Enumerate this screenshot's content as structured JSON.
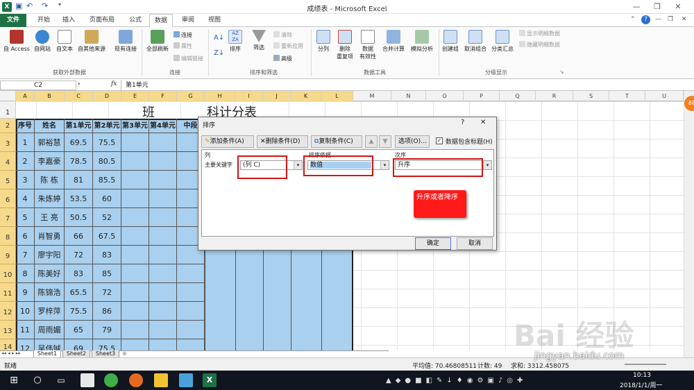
{
  "window": {
    "title": "成绩表 - Microsoft Excel"
  },
  "tabs": [
    "文件",
    "开始",
    "插入",
    "页面布局",
    "公式",
    "数据",
    "审阅",
    "视图"
  ],
  "ribbon": {
    "get_external": {
      "access": "自 Access",
      "web": "自网站",
      "text": "自文本",
      "other": "自其他来源",
      "existing": "现有连接",
      "group": "获取外部数据"
    },
    "connections": {
      "refresh": "全部刷新",
      "connect": "连接",
      "properties": "属性",
      "edit_links": "编辑链接",
      "group": "连接"
    },
    "sort_filter": {
      "sort": "排序",
      "filter": "筛选",
      "clear": "清除",
      "reapply": "重新应用",
      "advanced": "高级",
      "group": "排序和筛选"
    },
    "data_tools": {
      "text_to_cols": "分列",
      "remove_dup_1": "删除",
      "remove_dup_2": "重复项",
      "validation_1": "数据",
      "validation_2": "有效性",
      "consolidate": "合并计算",
      "whatif": "模拟分析",
      "group": "数据工具"
    },
    "outline": {
      "group_btn": "创建组",
      "ungroup": "取消组合",
      "subtotal": "分类汇总",
      "show_detail": "显示明细数据",
      "hide_detail": "隐藏明细数据",
      "group": "分级显示"
    }
  },
  "formula_bar": {
    "name_box": "C2",
    "fx": "fx",
    "value": "第1单元"
  },
  "columns": [
    "A",
    "B",
    "C",
    "D",
    "E",
    "F",
    "G",
    "H",
    "I",
    "J",
    "K",
    "L",
    "M",
    "N",
    "O",
    "P",
    "Q",
    "R",
    "S",
    "T",
    "U"
  ],
  "rows": [
    "1",
    "2",
    "3",
    "4",
    "5",
    "6",
    "7",
    "8",
    "9",
    "10",
    "11",
    "12",
    "13",
    "14"
  ],
  "sheet": {
    "title_left": "班",
    "title_right": "科计分表",
    "headers": [
      "序号",
      "姓名",
      "第1单元",
      "第2单元",
      "第3单元",
      "第4单元",
      "中段"
    ],
    "data": [
      [
        "1",
        "郭裕慧",
        "69.5",
        "75.5"
      ],
      [
        "2",
        "李嘉豪",
        "78.5",
        "80.5"
      ],
      [
        "3",
        "陈 栋",
        "81",
        "85.5"
      ],
      [
        "4",
        "朱炼婷",
        "53.5",
        "60"
      ],
      [
        "5",
        "王 亮",
        "50.5",
        "52"
      ],
      [
        "6",
        "肖智勇",
        "66",
        "67.5"
      ],
      [
        "7",
        "廖宇阳",
        "72",
        "83"
      ],
      [
        "8",
        "陈美好",
        "83",
        "85"
      ],
      [
        "9",
        "陈锦浩",
        "65.5",
        "72"
      ],
      [
        "10",
        "罗梓萍",
        "75.5",
        "86"
      ],
      [
        "11",
        "周雨媚",
        "65",
        "79"
      ],
      [
        "12",
        "吴伟铖",
        "69",
        "75.5"
      ]
    ]
  },
  "dialog": {
    "title": "排序",
    "help": "?",
    "close": "✕",
    "add": "添加条件(A)",
    "delete": "删除条件(D)",
    "copy": "复制条件(C)",
    "options": "选项(O)...",
    "has_header": "数据包含标题(H)",
    "col_header": "列",
    "sorton_header": "排序依据",
    "order_header": "次序",
    "row_label": "主要关键字",
    "column": "(列 C)",
    "sort_on": "数值",
    "order": "升序",
    "annotation": "升序或者降序",
    "ok": "确定",
    "cancel": "取消"
  },
  "status": {
    "ready": "就绪",
    "average": "平均值: 70.46808511",
    "count": "计数: 49",
    "sum": "求和: 3312.458075"
  },
  "sheets": [
    "Sheet1",
    "Sheet2",
    "Sheet3"
  ],
  "taskbar": {
    "time": "10:13",
    "date": "2018/1/1/周一"
  },
  "watermark": {
    "text": "Bai 经验",
    "url": "jingyan.baidu.com"
  },
  "colors": {
    "excel_green": "#1e7145",
    "selection": "#a9d0ee",
    "red": "#d11414",
    "annotation_bg": "#ff1a1a"
  }
}
